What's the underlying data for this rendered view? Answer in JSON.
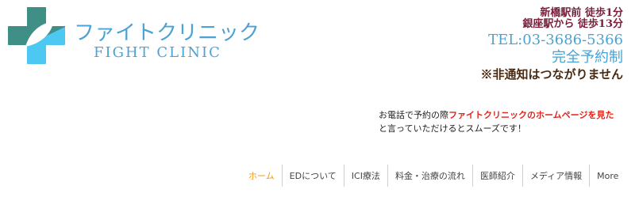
{
  "logo": {
    "name_jp": "ファイトクリニック",
    "name_en": "FIGHT CLINIC",
    "colors": {
      "dark_teal": "#3f8f87",
      "light_blue": "#4cc8f2",
      "text": "#4aa3d4"
    }
  },
  "info": {
    "access_shinbashi": "新橋駅前 徒歩1分",
    "access_ginza": "銀座駅から 徒歩13分",
    "tel": "TEL:03-3686-5366",
    "reservation": "完全予約制",
    "notice": "※非通知はつながりません"
  },
  "callout": {
    "prefix": "お電話で予約の際",
    "highlight": "ファイトクリニックのホームページを見た",
    "suffix": "と言っていただけるとスムーズです！"
  },
  "nav": {
    "items": [
      "ホーム",
      "EDについて",
      "ICI療法",
      "料金・治療の流れ",
      "医師紹介",
      "メディア情報",
      "More"
    ],
    "active_color": "#f29a1a"
  }
}
